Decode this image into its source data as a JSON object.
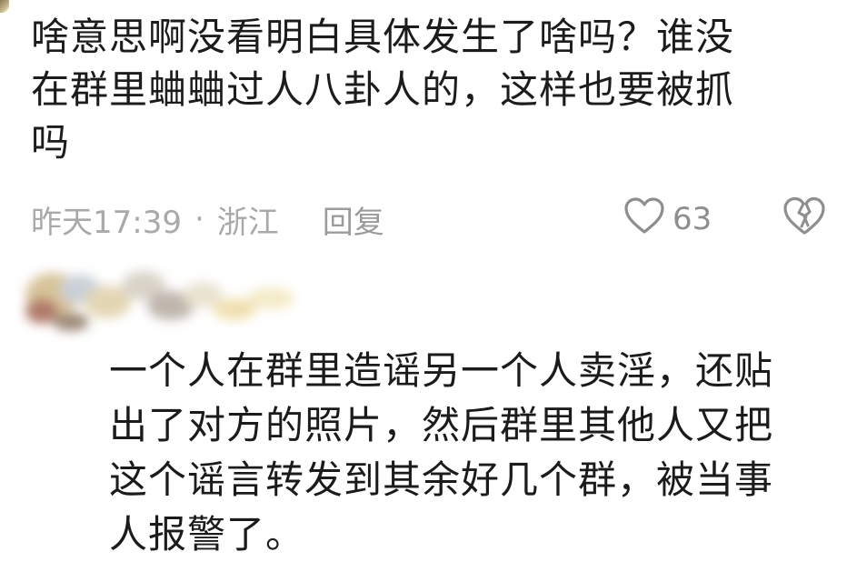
{
  "comment": {
    "text": "啥意思啊没看明白具体发生了啥吗？谁没\n在群里蛐蛐过人八卦人的，这样也要被抓\n吗",
    "time": "昨天17:39",
    "separator": "·",
    "location": "浙江",
    "reply_label": "回复",
    "like_count": "63",
    "like_icon": "heart-outline-icon",
    "dislike_icon": "broken-heart-icon"
  },
  "reply": {
    "avatar": "blurred-avatar",
    "text": "一个人在群里造谣另一个人卖淫，还贴\n出了对方的照片，然后群里其他人又把\n这个谣言转发到其余好几个群，被当事\n人报警了。"
  },
  "colors": {
    "text_primary": "#1c1c1c",
    "text_meta": "#a9a9a9",
    "icon_gray": "#8e8e8e",
    "background": "#ffffff"
  }
}
